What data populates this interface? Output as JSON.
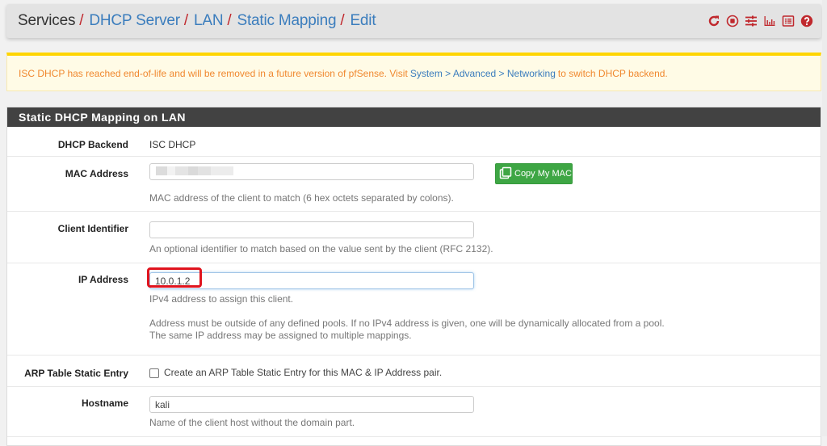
{
  "header": {
    "breadcrumb": {
      "root": "Services",
      "separator": "/",
      "links": [
        "DHCP Server",
        "LAN",
        "Static Mapping",
        "Edit"
      ]
    },
    "icons": [
      "reload-icon",
      "stop-circle-icon",
      "sliders-icon",
      "bar-chart-icon",
      "log-list-icon",
      "help-icon"
    ],
    "icon_color": "#c0282d"
  },
  "alert": {
    "text_before": "ISC DHCP has reached end-of-life and will be removed in a future version of pfSense. Visit",
    "link": "System > Advanced > Networking",
    "text_after": "to switch DHCP backend."
  },
  "panel": {
    "title": "Static DHCP Mapping on LAN",
    "fields": {
      "dhcp_backend": {
        "label": "DHCP Backend",
        "value": "ISC DHCP"
      },
      "mac_address": {
        "label": "MAC Address",
        "value": "",
        "value_obscured": true,
        "button": "Copy My MAC",
        "help": "MAC address of the client to match (6 hex octets separated by colons)."
      },
      "client_identifier": {
        "label": "Client Identifier",
        "value": "",
        "help": "An optional identifier to match based on the value sent by the client (RFC 2132)."
      },
      "ip_address": {
        "label": "IP Address",
        "value": "10.0.1.2",
        "help1": "IPv4 address to assign this client.",
        "help2": "Address must be outside of any defined pools. If no IPv4 address is given, one will be dynamically allocated from a pool.",
        "help3": "The same IP address may be assigned to multiple mappings."
      },
      "arp_static": {
        "label": "ARP Table Static Entry",
        "checked": false,
        "text": "Create an ARP Table Static Entry for this MAC & IP Address pair."
      },
      "hostname": {
        "label": "Hostname",
        "value": "kali",
        "help": "Name of the client host without the domain part."
      }
    }
  }
}
